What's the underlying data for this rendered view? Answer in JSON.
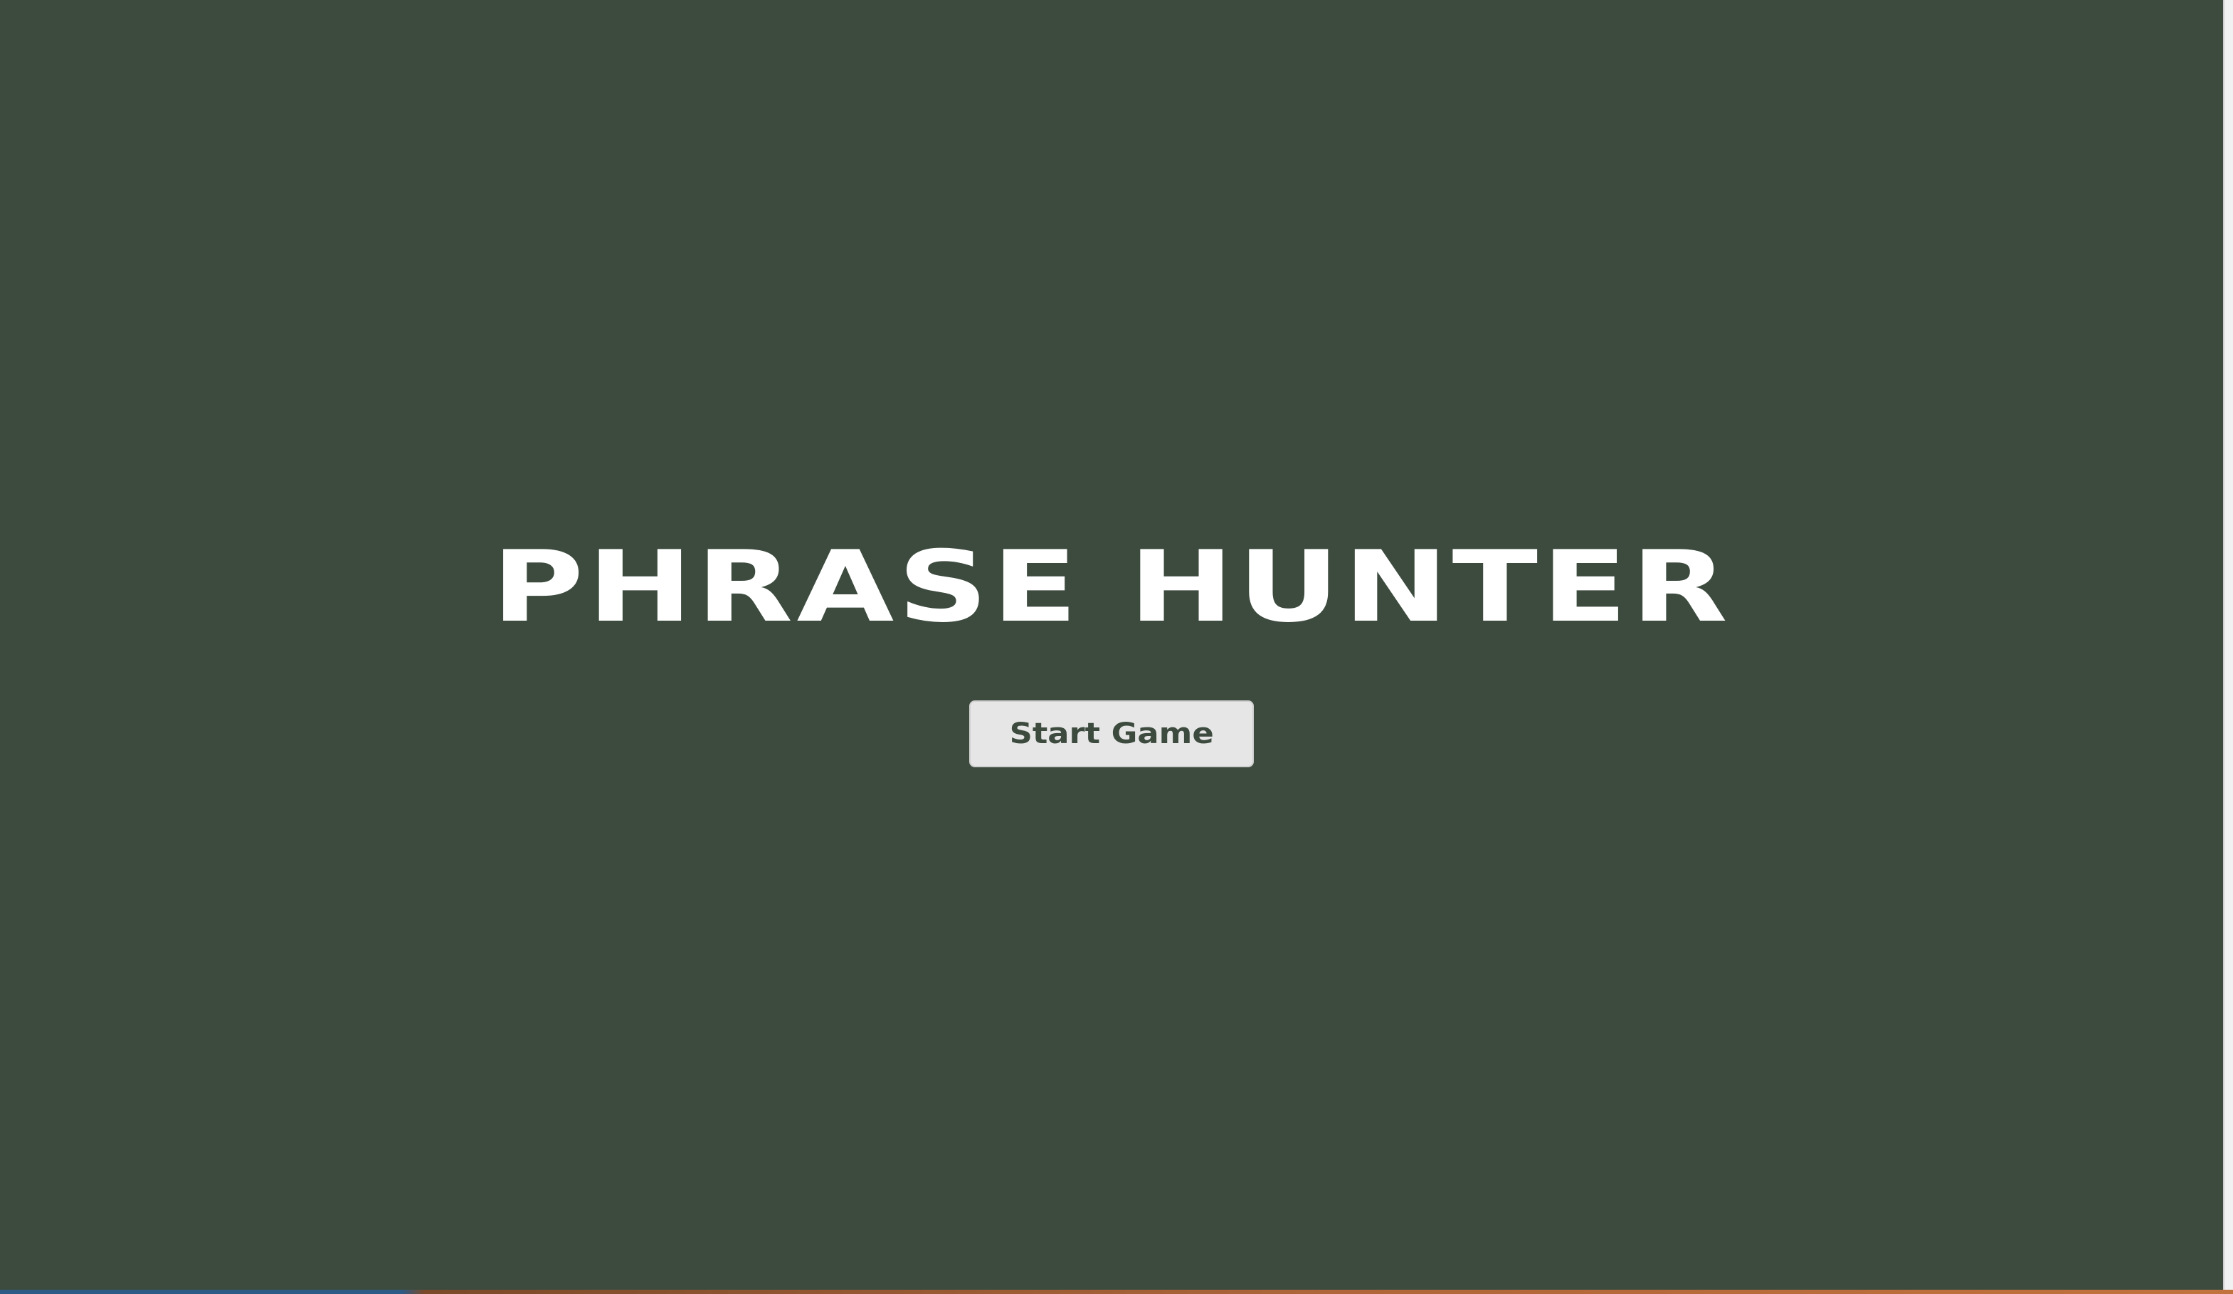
{
  "overlay": {
    "title": "PHRASE HUNTER",
    "start_button_label": "Start Game"
  },
  "colors": {
    "background": "#3d4b3f",
    "title_text": "#ffffff",
    "button_background": "#e6e6e6",
    "button_text": "#3d4b3f"
  }
}
